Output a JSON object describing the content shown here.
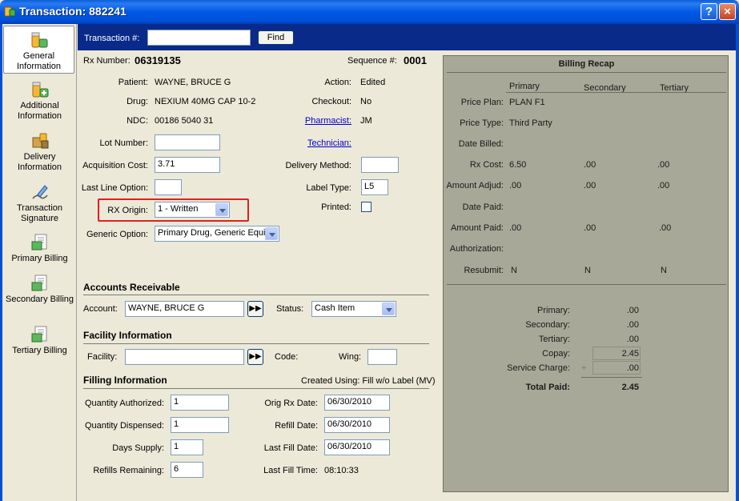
{
  "window": {
    "title": "Transaction: 882241",
    "help_icon": "?",
    "close_icon": "×"
  },
  "sidebar": {
    "items": [
      {
        "label": "General Information",
        "icon": "pill-bottles-icon",
        "active": true
      },
      {
        "label": "Additional Information",
        "icon": "pill-bottles-plus-icon"
      },
      {
        "label": "Delivery Information",
        "icon": "delivery-box-icon"
      },
      {
        "label": "Transaction Signature",
        "icon": "signature-pen-icon"
      },
      {
        "label": "Primary Billing",
        "icon": "primary-billing-icon"
      },
      {
        "label": "Secondary Billing",
        "icon": "secondary-billing-icon"
      },
      {
        "label": "Tertiary Billing",
        "icon": "tertiary-billing-icon"
      }
    ]
  },
  "search": {
    "label": "Transaction #:",
    "value": "",
    "find_label": "Find"
  },
  "rx": {
    "rx_number_label": "Rx Number:",
    "rx_number": "06319135",
    "sequence_label": "Sequence #:",
    "sequence": "0001",
    "patient_label": "Patient:",
    "patient": "WAYNE, BRUCE G",
    "drug_label": "Drug:",
    "drug": "NEXIUM 40MG CAP 10-2",
    "ndc_label": "NDC:",
    "ndc": "00186 5040 31",
    "lot_label": "Lot Number:",
    "lot": "",
    "acq_label": "Acquisition Cost:",
    "acq": "3.71",
    "last_line_label": "Last Line Option:",
    "last_line": "",
    "origin_label": "RX Origin:",
    "origin": "1 - Written",
    "generic_label": "Generic Option:",
    "generic": "Primary Drug, Generic Equiv",
    "action_label": "Action:",
    "action": "Edited",
    "checkout_label": "Checkout:",
    "checkout": "No",
    "pharmacist_label": "Pharmacist:",
    "pharmacist": "JM",
    "technician_label": "Technician:",
    "delivery_label": "Delivery Method:",
    "delivery": "",
    "label_type_label": "Label Type:",
    "label_type": "L5",
    "printed_label": "Printed:"
  },
  "ar": {
    "heading": "Accounts Receivable",
    "account_label": "Account:",
    "account": "WAYNE, BRUCE G",
    "status_label": "Status:",
    "status": "Cash Item"
  },
  "facility": {
    "heading": "Facility Information",
    "facility_label": "Facility:",
    "facility": "",
    "code_label": "Code:",
    "wing_label": "Wing:",
    "wing": ""
  },
  "filling": {
    "heading": "Filling Information",
    "created_using": "Created Using: Fill w/o Label (MV)",
    "qty_auth_label": "Quantity Authorized:",
    "qty_auth": "1",
    "qty_disp_label": "Quantity Dispensed:",
    "qty_disp": "1",
    "days_label": "Days Supply:",
    "days": "1",
    "refills_label": "Refills Remaining:",
    "refills": "6",
    "orig_date_label": "Orig Rx Date:",
    "orig_date": "06/30/2010",
    "refill_date_label": "Refill Date:",
    "refill_date": "06/30/2010",
    "last_fill_label": "Last Fill Date:",
    "last_fill": "06/30/2010",
    "last_time_label": "Last Fill Time:",
    "last_time": "08:10:33"
  },
  "recap": {
    "title": "Billing Recap",
    "cols": [
      "Primary",
      "Secondary",
      "Tertiary"
    ],
    "price_plan_label": "Price Plan:",
    "price_plan": "PLAN F1",
    "price_type_label": "Price Type:",
    "price_type": "Third Party",
    "date_billed_label": "Date Billed:",
    "rx_cost_label": "Rx Cost:",
    "rx_cost": [
      "6.50",
      ".00",
      ".00"
    ],
    "amt_adj_label": "Amount Adjud:",
    "amt_adj": [
      ".00",
      ".00",
      ".00"
    ],
    "date_paid_label": "Date Paid:",
    "amt_paid_label": "Amount Paid:",
    "amt_paid": [
      ".00",
      ".00",
      ".00"
    ],
    "auth_label": "Authorization:",
    "resubmit_label": "Resubmit:",
    "resubmit": [
      "N",
      "N",
      "N"
    ],
    "tot_primary_label": "Primary:",
    "tot_primary": ".00",
    "tot_secondary_label": "Secondary:",
    "tot_secondary": ".00",
    "tot_tertiary_label": "Tertiary:",
    "tot_tertiary": ".00",
    "copay_label": "Copay:",
    "copay": "2.45",
    "service_label": "Service Charge:",
    "service_plus": "+",
    "service": ".00",
    "total_label": "Total Paid:",
    "total": "2.45"
  },
  "colors": {
    "title_blue": "#0058e6",
    "header_navy": "#0a2a8a",
    "recap_bg": "#a8a898",
    "highlight_red": "#e02020",
    "link": "#0000cc"
  }
}
